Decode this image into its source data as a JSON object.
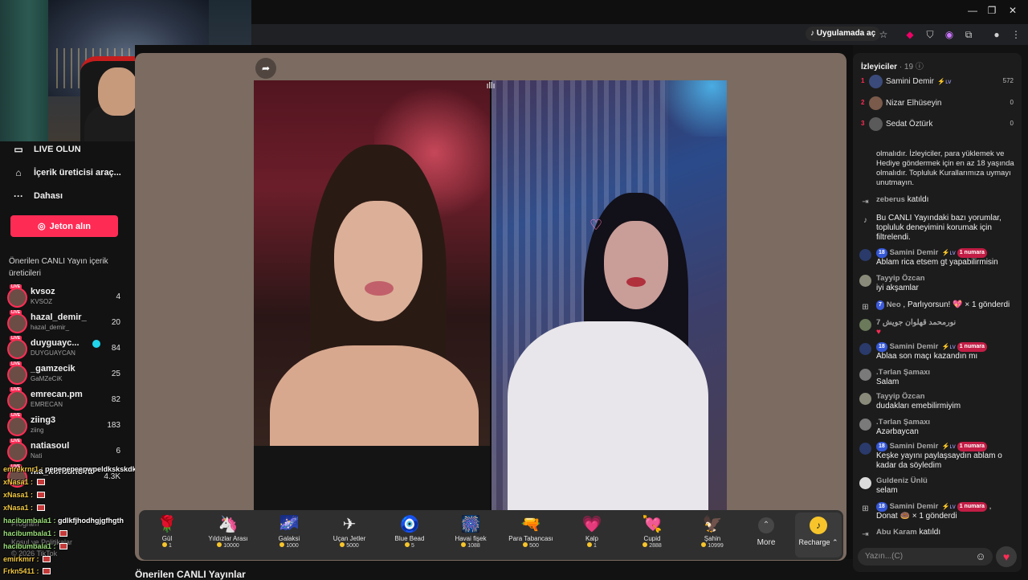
{
  "browser": {
    "open_in_app": "Uygulamada aç",
    "window_controls": [
      "minimize-icon",
      "restore-icon",
      "close-icon"
    ]
  },
  "sidebar": {
    "nav": [
      {
        "icon": "video-camera-icon",
        "label": "LIVE OLUN"
      },
      {
        "icon": "creator-tools-icon",
        "label": "İçerik üreticisi araç..."
      },
      {
        "icon": "more-dots-icon",
        "label": "Dahası"
      }
    ],
    "jeton_button": "Jeton alın",
    "recommended_title": "Önerilen CANLI Yayın içerik üreticileri",
    "creators": [
      {
        "name": "kvsoz",
        "sub": "KVSOZ",
        "count": "4"
      },
      {
        "name": "hazal_demir_",
        "sub": "hazal_demir_",
        "count": "20"
      },
      {
        "name": "duyguayc...",
        "sub": "DUYGUAYCAN",
        "count": "84",
        "verified": true
      },
      {
        "name": "_gamzecik",
        "sub": "GaMZeCiK",
        "count": "25"
      },
      {
        "name": "emrecan.pm",
        "sub": "EMRECAN",
        "count": "82"
      },
      {
        "name": "ziing3",
        "sub": "ziing",
        "count": "183"
      },
      {
        "name": "natiasoul",
        "sub": "Nati",
        "count": "6"
      },
      {
        "name": "nia_korbanova",
        "sub": "",
        "count": "4.3K"
      }
    ],
    "live_badge": "LIVE"
  },
  "overlay_chat": [
    {
      "user": "emrekrnr1 :",
      "msg": "pepepepeepwpeldkskskdk",
      "color": "y"
    },
    {
      "user": "xNasa1 :",
      "msg": "",
      "color": "y"
    },
    {
      "user": "xNasa1 :",
      "msg": "",
      "color": "y"
    },
    {
      "user": "xNasa1 :",
      "msg": "",
      "color": "y"
    },
    {
      "user": "hacibumbala1 :",
      "msg": "gdlkfjhodhgjgfhgth",
      "color": "g"
    },
    {
      "user": "hacibumbala1 :",
      "msg": "",
      "color": "g"
    },
    {
      "user": "hacibumbala1 :",
      "msg": "",
      "color": "g"
    },
    {
      "user": "emirkmrr :",
      "msg": "",
      "color": "y"
    },
    {
      "user": "Frkn5411 :",
      "msg": "",
      "color": "y"
    }
  ],
  "overlay_ghost": [
    "Program",
    "Koşul ve Politikalar",
    "© 2026 TikTok"
  ],
  "stage": {
    "gifts": [
      {
        "icon": "🌹",
        "name": "Gül",
        "price": "1"
      },
      {
        "icon": "🦄",
        "name": "Yıldızlar Arası",
        "price": "10000"
      },
      {
        "icon": "🌌",
        "name": "Galaksi",
        "price": "1000"
      },
      {
        "icon": "✈",
        "name": "Uçan Jetler",
        "price": "5000"
      },
      {
        "icon": "🧿",
        "name": "Blue Bead",
        "price": "5"
      },
      {
        "icon": "🎆",
        "name": "Havai fişek",
        "price": "1088"
      },
      {
        "icon": "🔫",
        "name": "Para Tabancası",
        "price": "500"
      },
      {
        "icon": "💗",
        "name": "Kalp",
        "price": "1"
      },
      {
        "icon": "💘",
        "name": "Cupid",
        "price": "2888"
      },
      {
        "icon": "🦅",
        "name": "Şahin",
        "price": "10999"
      }
    ],
    "more_label": "More",
    "recharge_label": "Recharge",
    "below_title": "Önerilen CANLI Yayınlar"
  },
  "right_panel": {
    "viewers_label": "İzleyiciler",
    "viewers_count": "· 19",
    "viewers": [
      {
        "rank": "1",
        "name": "Samini Demir",
        "score": "572",
        "lv": true
      },
      {
        "rank": "2",
        "name": "Nizar Elhüseyin",
        "score": "0"
      },
      {
        "rank": "3",
        "name": "Sedat Öztürk",
        "score": "0"
      }
    ],
    "system_notice": "olmalıdır. İzleyiciler, para yüklemek ve Hediye göndermek için en az 18 yaşında olmalıdır. Topluluk Kurallarımıza uymayı unutmayın.",
    "messages": [
      {
        "type": "join",
        "user": "zeberus",
        "text": "katıldı"
      },
      {
        "type": "system",
        "text": "Bu CANLI Yayındaki bazı yorumlar, topluluk deneyimini korumak için filtrelendi."
      },
      {
        "type": "chat",
        "user": "Samini Demir",
        "badges": [
          "18",
          "1 numara"
        ],
        "text": "Ablam rica etsem gt yapabilirmisin"
      },
      {
        "type": "chat",
        "user": "Tayyip Özcan",
        "text": "iyi akşamlar"
      },
      {
        "type": "gift",
        "badge": "7",
        "user": "Neo",
        "text": ", Parlıyorsun!",
        "suffix": "× 1 gönderdi"
      },
      {
        "type": "chat",
        "user": "نورمحمد قهلوان جويش 7",
        "text": "♥"
      },
      {
        "type": "chat",
        "user": "Samini Demir",
        "badges": [
          "18",
          "1 numara"
        ],
        "text": "Ablaa son maçı kazandın mı"
      },
      {
        "type": "chat",
        "user": ".Tərlan Şamaxı",
        "text": "Salam"
      },
      {
        "type": "chat",
        "user": "Tayyip Özcan",
        "text": "dudakları emebilirmiyim"
      },
      {
        "type": "chat",
        "user": ".Tərlan Şamaxı",
        "text": "Azərbaycan"
      },
      {
        "type": "chat",
        "user": "Samini Demir",
        "badges": [
          "18",
          "1 numara"
        ],
        "text": "Keşke yayını paylaşsaydın ablam o kadar da söyledim"
      },
      {
        "type": "chat",
        "user": "Guldeniz Ünlü",
        "text": "selam"
      },
      {
        "type": "gift2",
        "user": "Samini Demir",
        "badges": [
          "18",
          "1 numara"
        ],
        "text": "Donat",
        "suffix": "× 1 gönderdi"
      },
      {
        "type": "join",
        "user": "Abu Karam",
        "text": "katıldı"
      }
    ],
    "input_placeholder": "Yazın...(C)"
  }
}
